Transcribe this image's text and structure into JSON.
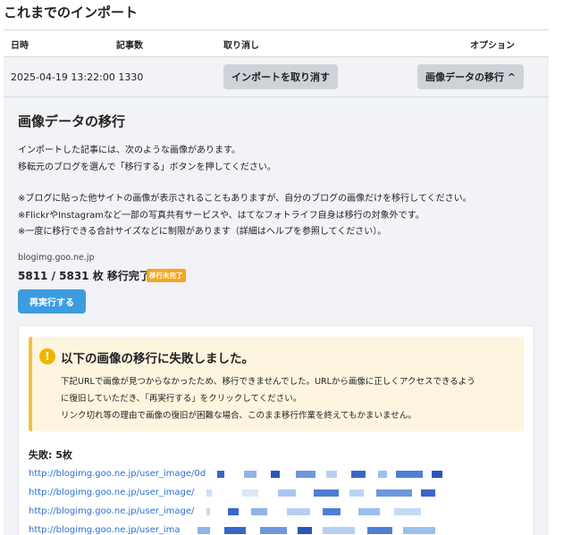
{
  "page": {
    "title": "これまでのインポート"
  },
  "table": {
    "headers": {
      "date": "日時",
      "count": "記事数",
      "cancel": "取り消し",
      "options": "オプション"
    },
    "row": {
      "date": "2025-04-19 13:22:00 1330",
      "cancel_button": "インポートを取り消す",
      "migrate_button": "画像データの移行 ^"
    }
  },
  "migration": {
    "title": "画像データの移行",
    "desc1": "インポートした記事には、次のような画像があります。",
    "desc2": "移転元のブログを選んで「移行する」ボタンを押してください。",
    "note1": "※ブログに貼った他サイトの画像が表示されることもありますが、自分のブログの画像だけを移行してください。",
    "note2": "※FlickrやInstagramなど一部の写真共有サービスや、はてなフォトライフ自身は移行の対象外です。",
    "note3": "※一度に移行できる合計サイズなどに制限があります（詳細はヘルプを参照してください）。",
    "domain": "blogimg.goo.ne.jp",
    "count": "5811 / 5831 枚 移行完了",
    "badge": "移行未完了",
    "retry_button": "再実行する"
  },
  "warning": {
    "icon": "exclamation-icon",
    "title": "以下の画像の移行に失敗しました。",
    "line1": "下記URLで画像が見つからなかったため、移行できませんでした。URLから画像に正しくアクセスできるよう",
    "line2": "に復旧していただき、「再実行する」をクリックしてください。",
    "line3": "リンク切れ等の理由で画像の復旧が困難な場合、このまま移行作業を終えてもかまいません。"
  },
  "failures": {
    "label": "失敗: 5枚",
    "links": [
      "http://blogimg.goo.ne.jp/user_image/0d",
      "http://blogimg.goo.ne.jp/user_image/",
      "http://blogimg.goo.ne.jp/user_image/",
      "http://blogimg.goo.ne.jp/user_ima"
    ]
  },
  "colors": {
    "accent": "#3d9be0",
    "badge": "#f5a623",
    "link": "#2a6fd1",
    "warning_bg": "#fdf5e0"
  }
}
